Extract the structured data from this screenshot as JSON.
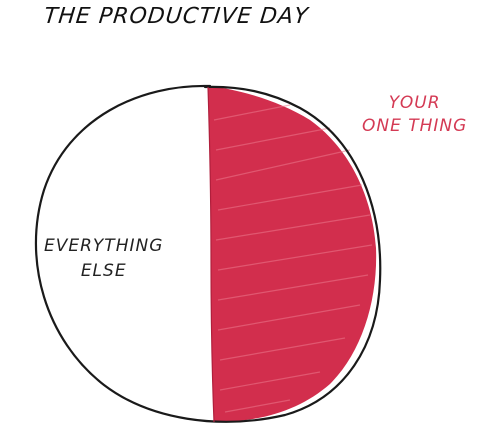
{
  "title": "THE PRODUCTIVE DAY",
  "segments": {
    "one_thing": {
      "line1": "YOUR",
      "line2": "ONE THING",
      "color": "#d22e4d"
    },
    "everything_else": {
      "line1": "EVERYTHING",
      "line2": "ELSE",
      "color": "#ffffff"
    }
  },
  "outline_color": "#1a1a1a"
}
